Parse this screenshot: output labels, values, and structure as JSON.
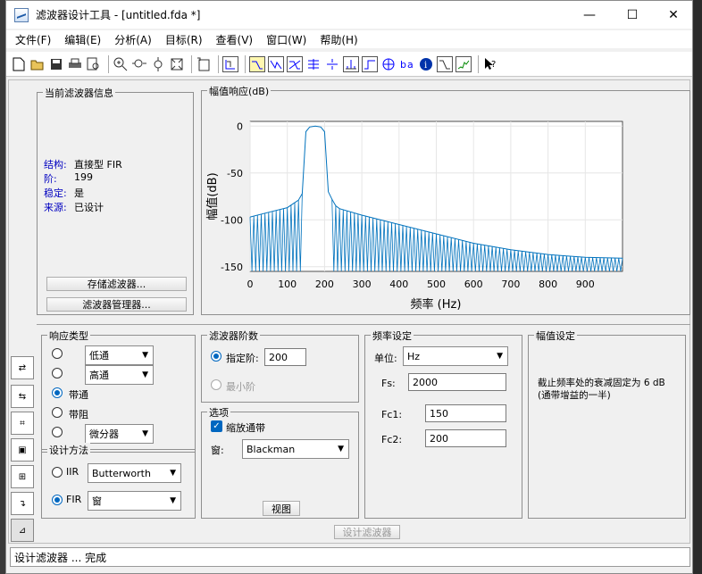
{
  "window": {
    "title": "滤波器设计工具 - [untitled.fda *]",
    "min": "—",
    "max": "☐",
    "close": "✕"
  },
  "menu": [
    "文件(F)",
    "编辑(E)",
    "分析(A)",
    "目标(R)",
    "查看(V)",
    "窗口(W)",
    "帮助(H)"
  ],
  "toolbar_icons": [
    "new-icon",
    "open-icon",
    "save-icon",
    "print-icon",
    "print-preview-icon",
    "zoom-in-icon",
    "zoom-x-icon",
    "zoom-y-icon",
    "full-view-icon",
    "new-window-icon",
    "filter-spec-icon",
    "magnitude-response-icon",
    "phase-response-icon",
    "mag-phase-icon",
    "group-delay-icon",
    "phase-delay-icon",
    "impulse-response-icon",
    "step-response-icon",
    "pole-zero-icon",
    "coefficients-icon",
    "info-icon",
    "magnitude-estimate-icon",
    "round-off-noise-icon",
    "whats-this-icon"
  ],
  "info": {
    "title": "当前滤波器信息",
    "rows": [
      {
        "k": "结构:",
        "v": "直接型 FIR"
      },
      {
        "k": "阶:",
        "v": "199"
      },
      {
        "k": "稳定:",
        "v": "是"
      },
      {
        "k": "来源:",
        "v": "已设计"
      }
    ],
    "store_btn": "存储滤波器...",
    "manager_btn": "滤波器管理器..."
  },
  "plot": {
    "title": "幅值响应(dB)",
    "xlabel": "频率 (Hz)",
    "ylabel": "幅值(dB)"
  },
  "chart_data": {
    "type": "line",
    "title": "幅值响应(dB)",
    "xlabel": "频率 (Hz)",
    "ylabel": "幅值(dB)",
    "xlim": [
      0,
      1000
    ],
    "ylim": [
      -155,
      5
    ],
    "xticks": [
      0,
      100,
      200,
      300,
      400,
      500,
      600,
      700,
      800,
      900
    ],
    "yticks": [
      0,
      -50,
      -100,
      -150
    ],
    "series": [
      {
        "x": [
          0,
          50,
          100,
          130,
          140,
          150,
          160,
          175,
          190,
          200,
          210,
          220,
          230,
          240,
          300,
          400,
          500,
          600,
          700,
          800,
          900,
          1000
        ],
        "y": [
          -97,
          -92,
          -87,
          -79,
          -72,
          -6,
          -1,
          0,
          -1,
          -6,
          -70,
          -78,
          -85,
          -88,
          -95,
          -105,
          -115,
          -125,
          -132,
          -137,
          -140,
          -141
        ]
      }
    ]
  },
  "response": {
    "title": "响应类型",
    "options": [
      "低通",
      "高通",
      "带通",
      "带阻",
      "微分器"
    ],
    "selected": 2
  },
  "design": {
    "title": "设计方法",
    "iir": "IIR",
    "iir_value": "Butterworth",
    "fir": "FIR",
    "fir_value": "窗"
  },
  "order": {
    "title": "滤波器阶数",
    "specify": "指定阶:",
    "specify_value": "200",
    "minimum": "最小阶"
  },
  "options": {
    "title": "选项",
    "scale": "缩放通带",
    "window_label": "窗:",
    "window_value": "Blackman",
    "view_btn": "视图"
  },
  "freq": {
    "title": "频率设定",
    "unit_label": "单位:",
    "unit": "Hz",
    "fs_label": "Fs:",
    "fs": "2000",
    "fc1_label": "Fc1:",
    "fc1": "150",
    "fc2_label": "Fc2:",
    "fc2": "200"
  },
  "mag": {
    "title": "幅值设定",
    "text": "截止频率处的衰减固定为 6 dB (通带增益的一半)"
  },
  "design_btn": "设计滤波器",
  "status": "设计滤波器 ... 完成"
}
